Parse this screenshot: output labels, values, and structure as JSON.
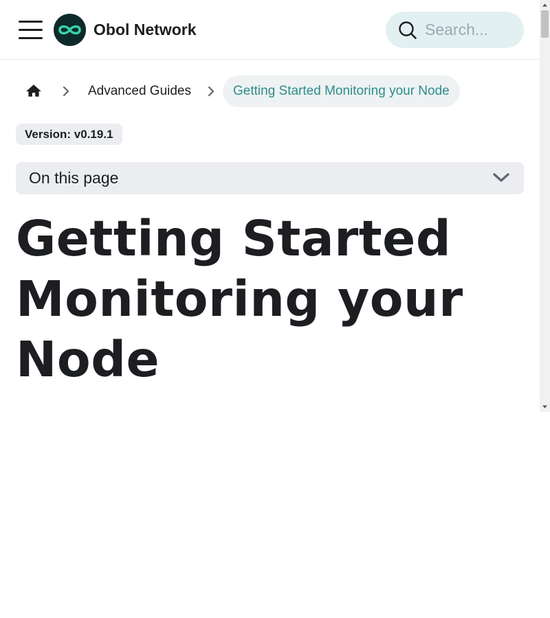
{
  "navbar": {
    "menu_icon": "hamburger-menu-icon",
    "logo_icon": "infinity-logo-icon",
    "brand_title": "Obol Network",
    "search": {
      "icon": "search-icon",
      "placeholder": "Search...",
      "value": ""
    }
  },
  "breadcrumbs": {
    "home_icon": "home-icon",
    "separator_icon": "chevron-right-icon",
    "items": [
      {
        "label": "Advanced Guides"
      },
      {
        "label": "Getting Started Monitoring your Node"
      }
    ]
  },
  "version_badge": "Version: v0.19.1",
  "toc": {
    "label": "On this page",
    "toggle_icon": "chevron-down-icon"
  },
  "page_title": "Getting Started Monitoring your Node",
  "colors": {
    "accent": "#2d8c8a",
    "logo_bg": "#0e2a2c",
    "logo_fg": "#3ad2a6",
    "search_bg": "#e3f0f1",
    "badge_bg": "#ebedf0",
    "text": "#1c1e21"
  }
}
